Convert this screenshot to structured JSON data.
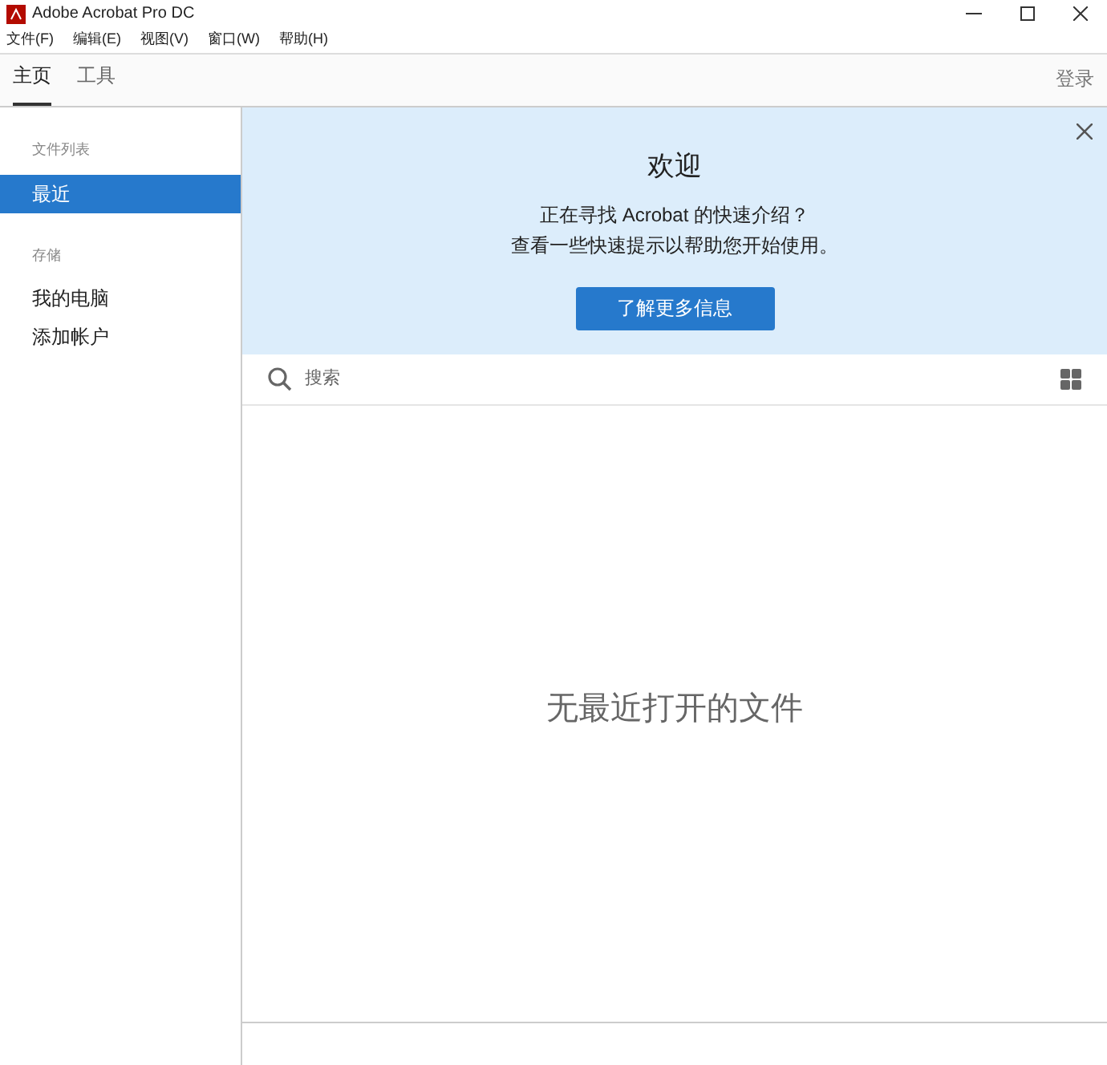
{
  "window": {
    "title": "Adobe Acrobat Pro DC"
  },
  "menu": [
    "文件(F)",
    "编辑(E)",
    "视图(V)",
    "窗口(W)",
    "帮助(H)"
  ],
  "tabs": [
    {
      "label": "主页",
      "selected": true
    },
    {
      "label": "工具",
      "selected": false
    }
  ],
  "sign_in": "登录",
  "sidebar": {
    "sections": [
      {
        "heading": "文件列表",
        "items": [
          {
            "label": "最近",
            "selected": true
          }
        ]
      },
      {
        "heading": "存储",
        "items": [
          {
            "label": "我的电脑",
            "selected": false
          },
          {
            "label": "添加帐户",
            "selected": false
          }
        ]
      }
    ]
  },
  "banner": {
    "title": "欢迎",
    "lines": [
      "正在寻找 Acrobat 的快速介绍？",
      "查看一些快速提示以帮助您开始使用。"
    ],
    "button": "了解更多信息"
  },
  "search": {
    "placeholder": "搜索"
  },
  "empty_message": "无最近打开的文件"
}
